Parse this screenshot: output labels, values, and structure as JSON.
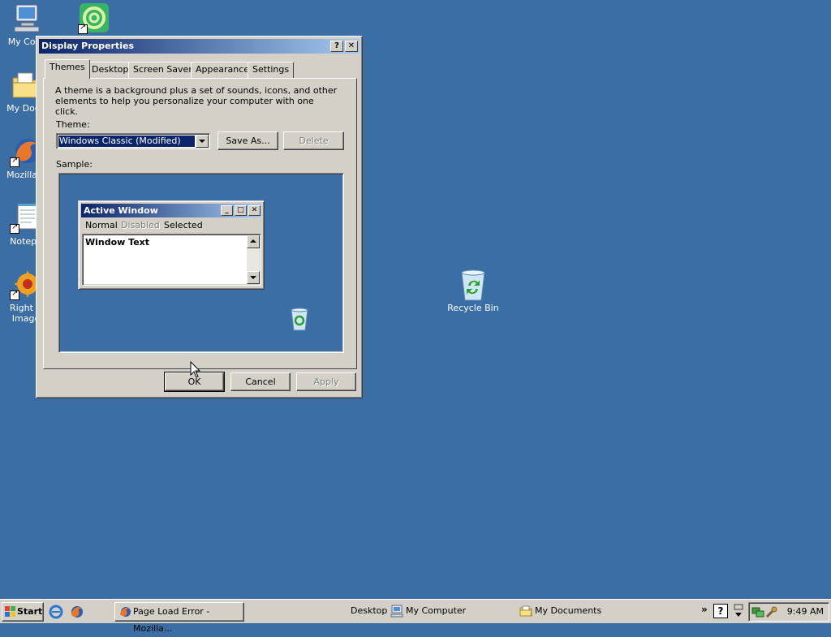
{
  "colors": {
    "desktop": "#3a6ea5",
    "face": "#d4d0c8",
    "title_start": "#0a246a",
    "title_end": "#a6caf0",
    "selection": "#0a246a"
  },
  "desktop_icons": [
    {
      "label": "My Com",
      "icon": "my-computer-icon"
    },
    {
      "label": "My Docu",
      "icon": "my-documents-icon"
    },
    {
      "label": "Mozilla F",
      "icon": "firefox-icon"
    },
    {
      "label": "Notepa",
      "icon": "notepad-icon"
    },
    {
      "label": "Right C\nImage",
      "icon": "right-click-image-icon"
    },
    {
      "label": "",
      "icon": "green-swirl-shortcut-icon"
    },
    {
      "label": "Recycle Bin",
      "icon": "recycle-bin-icon"
    }
  ],
  "dialog": {
    "title": "Display Properties",
    "help_btn": "?",
    "close_btn": "✕",
    "tabs": [
      {
        "label": "Themes",
        "active": true
      },
      {
        "label": "Desktop",
        "active": false
      },
      {
        "label": "Screen Saver",
        "active": false
      },
      {
        "label": "Appearance",
        "active": false
      },
      {
        "label": "Settings",
        "active": false
      }
    ],
    "description": "A theme is a background plus a set of sounds, icons, and other elements to help you personalize your computer with one click.",
    "theme_label": "Theme:",
    "theme_value": "Windows Classic (Modified)",
    "save_as": "Save As...",
    "delete": "Delete",
    "sample_label": "Sample:",
    "sample": {
      "window_title": "Active Window",
      "menu_normal": "Normal",
      "menu_disabled": "Disabled",
      "menu_selected": "Selected",
      "window_text": "Window Text"
    },
    "ok": "OK",
    "cancel": "Cancel",
    "apply": "Apply"
  },
  "taskbar": {
    "start": "Start",
    "quick_launch": [
      "internet-explorer-icon",
      "firefox-icon"
    ],
    "tasks": [
      {
        "label": "Page Load Error - Mozilla...",
        "icon": "firefox-icon"
      }
    ],
    "toolbars": [
      {
        "label": "Desktop",
        "icon": ""
      },
      {
        "label": "My Computer",
        "icon": "my-computer-icon"
      },
      {
        "label": "My Documents",
        "icon": "my-documents-icon"
      }
    ],
    "chevron": "»",
    "clock": "9:49 AM"
  }
}
